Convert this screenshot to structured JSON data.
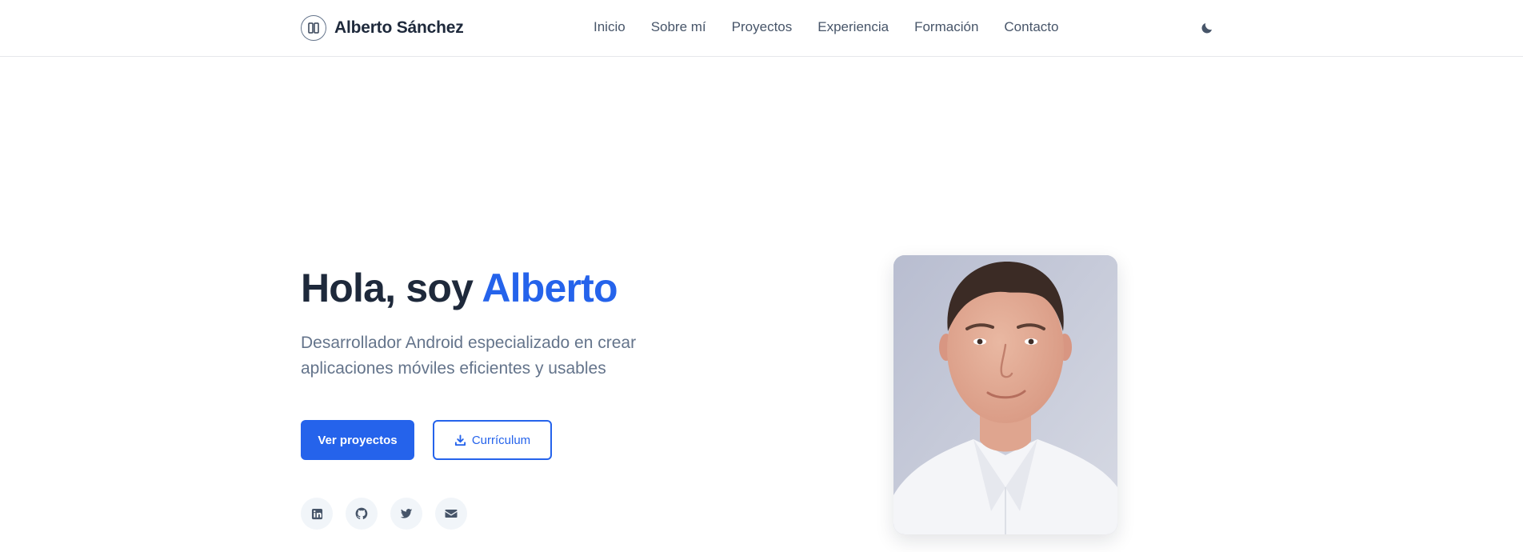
{
  "header": {
    "brand_name": "Alberto Sánchez",
    "logo_icon": "avatar-logo-icon",
    "nav": [
      {
        "label": "Inicio"
      },
      {
        "label": "Sobre mí"
      },
      {
        "label": "Proyectos"
      },
      {
        "label": "Experiencia"
      },
      {
        "label": "Formación"
      },
      {
        "label": "Contacto"
      }
    ],
    "theme_toggle_icon": "moon-icon"
  },
  "hero": {
    "greeting": "Hola, soy ",
    "name": "Alberto",
    "subtitle": "Desarrollador Android especializado en crear aplicaciones móviles eficientes y usables",
    "primary_button": "Ver proyectos",
    "secondary_button": "Currículum",
    "secondary_button_icon": "download-icon",
    "socials": [
      {
        "icon": "linkedin-icon"
      },
      {
        "icon": "github-icon"
      },
      {
        "icon": "twitter-icon"
      },
      {
        "icon": "email-icon"
      }
    ]
  },
  "colors": {
    "accent": "#2563eb",
    "text_dark": "#1e293b",
    "text_muted": "#64748b",
    "nav_text": "#475569",
    "border": "#e5e7eb",
    "social_bg": "#f1f5f9"
  }
}
